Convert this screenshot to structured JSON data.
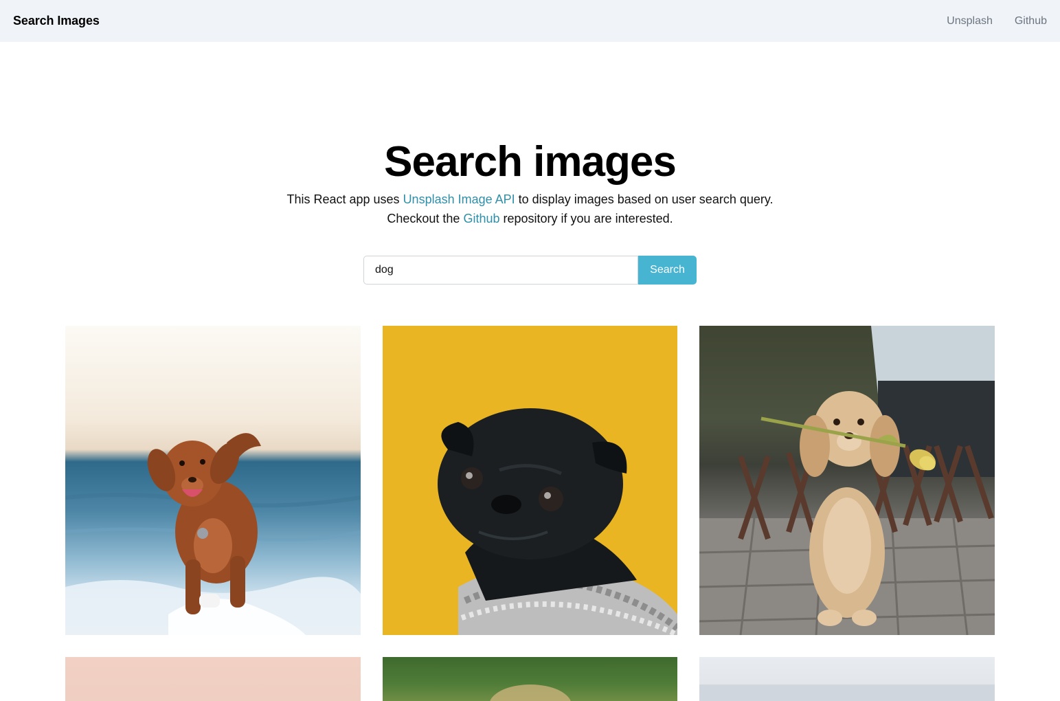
{
  "navbar": {
    "brand": "Search Images",
    "links": [
      "Unsplash",
      "Github"
    ]
  },
  "hero": {
    "title": "Search images",
    "line1_before": "This React app uses ",
    "line1_link": "Unsplash Image API",
    "line1_after": " to display images based on user search query.",
    "line2_before": "Checkout the ",
    "line2_link": "Github",
    "line2_after": " repository if you are interested."
  },
  "search": {
    "value": "dog",
    "button_label": "Search"
  },
  "colors": {
    "accent": "#47b5d2",
    "link": "#2f8fa8",
    "navbar_bg": "#f0f4f8"
  },
  "images": [
    {
      "subject": "brown-dog-running-on-beach"
    },
    {
      "subject": "black-pug-on-yellow-background"
    },
    {
      "subject": "golden-puppy-holding-flower"
    },
    {
      "subject": "pink-image-partially-visible"
    },
    {
      "subject": "green-image-partially-visible"
    },
    {
      "subject": "grey-image-partially-visible"
    }
  ]
}
